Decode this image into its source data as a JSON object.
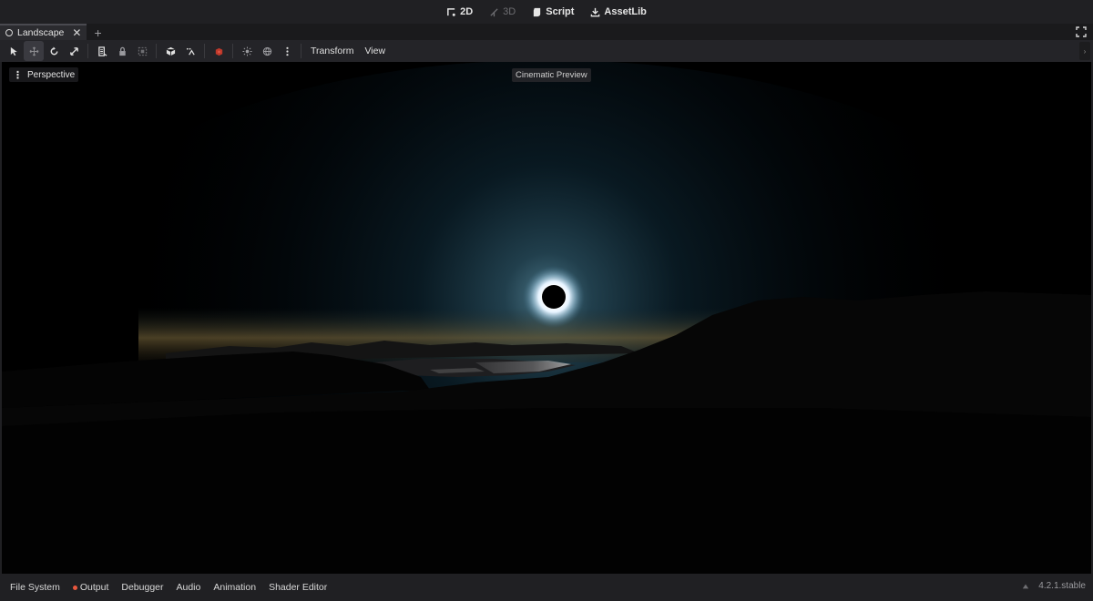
{
  "workspaces": [
    {
      "label": "2D",
      "icon": "2d-icon",
      "enabled": true
    },
    {
      "label": "3D",
      "icon": "3d-icon",
      "enabled": false
    },
    {
      "label": "Script",
      "icon": "script-icon",
      "enabled": true
    },
    {
      "label": "AssetLib",
      "icon": "assetlib-icon",
      "enabled": true
    }
  ],
  "tabs": {
    "scene_tab": "Landscape",
    "close": "✕",
    "add": "+"
  },
  "toolbar": {
    "transform_menu": "Transform",
    "view_menu": "View",
    "collapse": "›"
  },
  "viewport": {
    "perspective_dots": "⋮",
    "perspective_label": "Perspective",
    "cinematic_label": "Cinematic Preview"
  },
  "bottom_tabs": {
    "file_system": "File System",
    "output": "Output",
    "debugger": "Debugger",
    "audio": "Audio",
    "animation": "Animation",
    "shader_editor": "Shader Editor"
  },
  "version": "4.2.1.stable",
  "colors": {
    "output_indicator": "#e8573e",
    "accent": "#e6e6e6"
  }
}
